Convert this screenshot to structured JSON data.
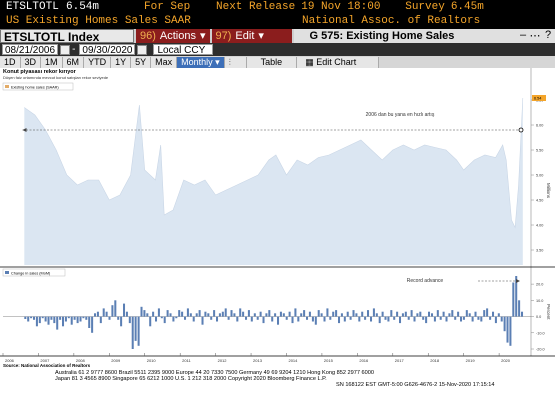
{
  "header": {
    "ticker": "ETSLTOTL",
    "last_value": "6.54m",
    "period": "For Sep",
    "next_release_label": "Next Release",
    "next_release_value": "19 Nov 18:00",
    "survey_label": "Survey",
    "survey_value": "6.45m",
    "description": "US Existing Homes Sales SAAR",
    "source": "National Assoc. of Realtors"
  },
  "toolbar": {
    "index_label": "ETSLTOTL Index",
    "actions_num": "96)",
    "actions_label": "Actions",
    "edit_num": "97)",
    "edit_label": "Edit",
    "graph_title": "G 575: Existing Home Sales",
    "date_start": "08/21/2006",
    "date_end": "09/30/2020",
    "currency": "Local CCY",
    "ranges": [
      "1D",
      "3D",
      "1M",
      "6M",
      "YTD",
      "1Y",
      "5Y",
      "Max"
    ],
    "frequency": "Monthly",
    "table_label": "Table",
    "edit_chart_label": "Edit Chart"
  },
  "chart": {
    "title": "Konut piyasası rekor kırıyor",
    "subtitle": "Düşen faiz ortamında mevcut konut satışları rekor seviyede",
    "legend_upper": "Existing home sales (SAAR)",
    "legend_lower": "Change in sales (MoM)",
    "annotation_upper": "2006 dan bu yana en hızlı artış",
    "annotation_lower": "Record advance",
    "ylabel_upper": "Millions",
    "ylabel_lower": "Percent",
    "last_value_label": "6.54",
    "source_note": "Source: National Association of Realtors",
    "footer_line1": "Australia 61 2 9777 8600 Brazil 5511 2395 9000 Europe 44 20 7330 7500 Germany 49 69 9204 1210 Hong Kong 852 2977 6000",
    "footer_line2": "Japan 81 3 4565 8900      Singapore 65 6212 1000      U.S. 1 212 318 2000      Copyright 2020 Bloomberg Finance L.P.",
    "footer_line3": "SN 168122 EST  GMT-5:00 G626-4676-2 15-Nov-2020 17:15:14"
  },
  "chart_data": [
    {
      "type": "area",
      "title": "Konut piyasası rekor kırıyor",
      "legend": [
        "Existing home sales (SAAR)"
      ],
      "ylabel": "Millions",
      "ylim": [
        3.2,
        6.7
      ],
      "x_ticks": [
        "2006",
        "2007",
        "2008",
        "2009",
        "2010",
        "2011",
        "2012",
        "2013",
        "2014",
        "2015",
        "2016",
        "2017",
        "2018",
        "2019",
        "2020"
      ],
      "y_ticks": [
        3.5,
        4.0,
        4.5,
        5.0,
        5.5,
        6.0,
        6.5
      ],
      "x": [
        2006.6,
        2006.9,
        2007.2,
        2007.5,
        2007.8,
        2008.1,
        2008.4,
        2008.7,
        2009.0,
        2009.3,
        2009.6,
        2009.85,
        2010.0,
        2010.3,
        2010.45,
        2010.55,
        2010.8,
        2011.1,
        2011.4,
        2011.7,
        2012.0,
        2012.3,
        2012.6,
        2012.9,
        2013.2,
        2013.5,
        2013.7,
        2014.0,
        2014.3,
        2014.6,
        2014.9,
        2015.2,
        2015.5,
        2015.8,
        2016.1,
        2016.4,
        2016.7,
        2017.0,
        2017.3,
        2017.6,
        2017.9,
        2018.2,
        2018.5,
        2018.8,
        2019.0,
        2019.3,
        2019.6,
        2019.9,
        2020.1,
        2020.2,
        2020.35,
        2020.45,
        2020.55,
        2020.67
      ],
      "values": [
        6.35,
        6.2,
        5.9,
        5.5,
        5.0,
        4.8,
        4.9,
        4.9,
        4.5,
        4.6,
        5.0,
        6.4,
        5.1,
        4.9,
        5.6,
        4.2,
        4.3,
        4.9,
        4.8,
        4.9,
        4.6,
        4.7,
        4.8,
        4.9,
        5.0,
        5.3,
        5.4,
        5.0,
        5.3,
        5.2,
        5.35,
        5.4,
        5.5,
        5.6,
        5.7,
        5.5,
        5.3,
        5.5,
        5.6,
        5.5,
        5.6,
        5.55,
        5.5,
        5.3,
        5.1,
        5.3,
        5.4,
        5.35,
        5.6,
        5.3,
        4.1,
        3.95,
        4.8,
        6.54
      ],
      "annotation": "2006 dan bu yana en hızlı artış"
    },
    {
      "type": "bar",
      "title": "",
      "legend": [
        "Change in sales (MoM)"
      ],
      "ylabel": "Percent",
      "ylim": [
        -20,
        25
      ],
      "y_ticks": [
        20,
        10,
        0,
        -10,
        -20
      ],
      "x_range": [
        2006,
        2020.9
      ],
      "values": [
        -1.5,
        -3,
        -1,
        -2,
        -6,
        -4,
        -1,
        -3,
        -5,
        -2,
        -4,
        -8,
        -2,
        -6,
        -3,
        -1,
        -5,
        -2,
        -4,
        -3,
        -1,
        -2,
        -7,
        -10,
        2,
        3,
        -4,
        5,
        3,
        -2,
        7,
        10,
        -2,
        -6,
        8,
        3,
        -4,
        -20,
        -15,
        -18,
        6,
        4,
        2,
        -6,
        3,
        -3,
        5,
        -1,
        -4,
        4,
        2,
        -3,
        -1,
        4,
        3,
        -2,
        5,
        2,
        -3,
        2,
        4,
        -5,
        3,
        2,
        -2,
        4,
        -3,
        2,
        3,
        5,
        -2,
        4,
        2,
        -3,
        5,
        3,
        -2,
        4,
        -3,
        2,
        -2,
        3,
        -4,
        2,
        4,
        -3,
        2,
        -5,
        3,
        2,
        -2,
        3,
        -4,
        5,
        -3,
        2,
        4,
        -2,
        3,
        -3,
        -5,
        4,
        2,
        -3,
        5,
        -2,
        3,
        4,
        -4,
        2,
        -3,
        3,
        -2,
        4,
        2,
        -3,
        3,
        -2,
        4,
        -3,
        5,
        2,
        -4,
        3,
        -2,
        -3,
        4,
        -2,
        3,
        -4,
        2,
        3,
        -2,
        4,
        -3,
        2,
        3,
        -2,
        -4,
        3,
        2,
        -3,
        4,
        -2,
        3,
        -3,
        2,
        4,
        -2,
        3,
        -3,
        -2,
        4,
        2,
        -3,
        3,
        -2,
        -3,
        4,
        5,
        -2,
        3,
        -4,
        2,
        -3,
        -9,
        -16,
        -18,
        21,
        25,
        10,
        3
      ]
    }
  ]
}
